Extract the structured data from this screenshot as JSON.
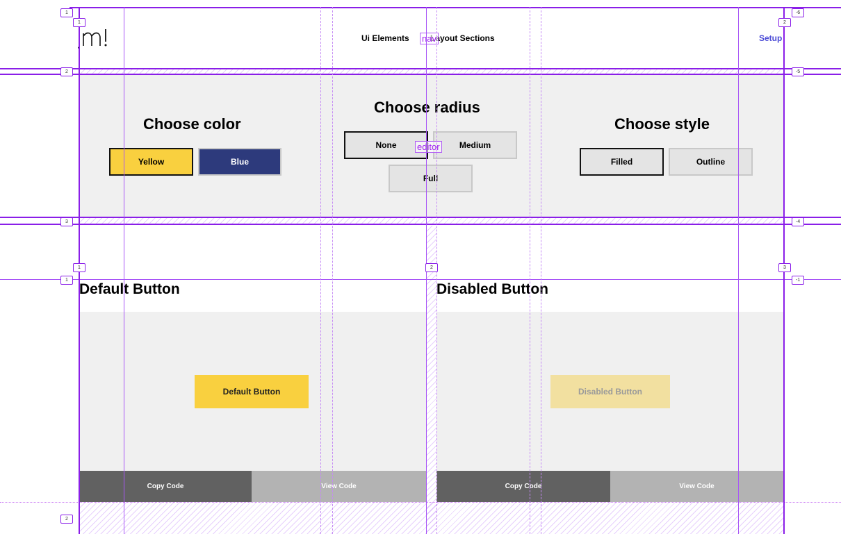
{
  "nav": {
    "logo_text": "jm!",
    "links": [
      "Ui Elements",
      "Layout Sections"
    ],
    "setup": "Setup",
    "tag": "nav"
  },
  "editor": {
    "tag": "editor",
    "color": {
      "title": "Choose color",
      "options": [
        "Yellow",
        "Blue"
      ],
      "selected": "Yellow"
    },
    "radius": {
      "title": "Choose radius",
      "options": [
        "None",
        "Medium",
        "Full"
      ],
      "selected": "None"
    },
    "style": {
      "title": "Choose style",
      "options": [
        "Filled",
        "Outline"
      ],
      "selected": "Filled"
    }
  },
  "sections": [
    {
      "title": "Default Button",
      "button": "Default Button",
      "copy": "Copy Code",
      "view": "View Code"
    },
    {
      "title": "Disabled Button",
      "button": "Disabled Button",
      "copy": "Copy Code",
      "view": "View Code"
    }
  ],
  "colors": {
    "yellow": "#f9d03f",
    "blue": "#2d3a7c",
    "disabled_yellow": "#f2e0a0",
    "guide": "#8a1ee8",
    "setup_link": "#4b4bd6"
  },
  "markers": {
    "left_top": [
      "1",
      "1",
      "2",
      "3",
      "1",
      "2"
    ],
    "right_top": [
      "-6",
      "2",
      "-5",
      "-4",
      "-1"
    ],
    "col": [
      "1",
      "2",
      "3"
    ]
  }
}
